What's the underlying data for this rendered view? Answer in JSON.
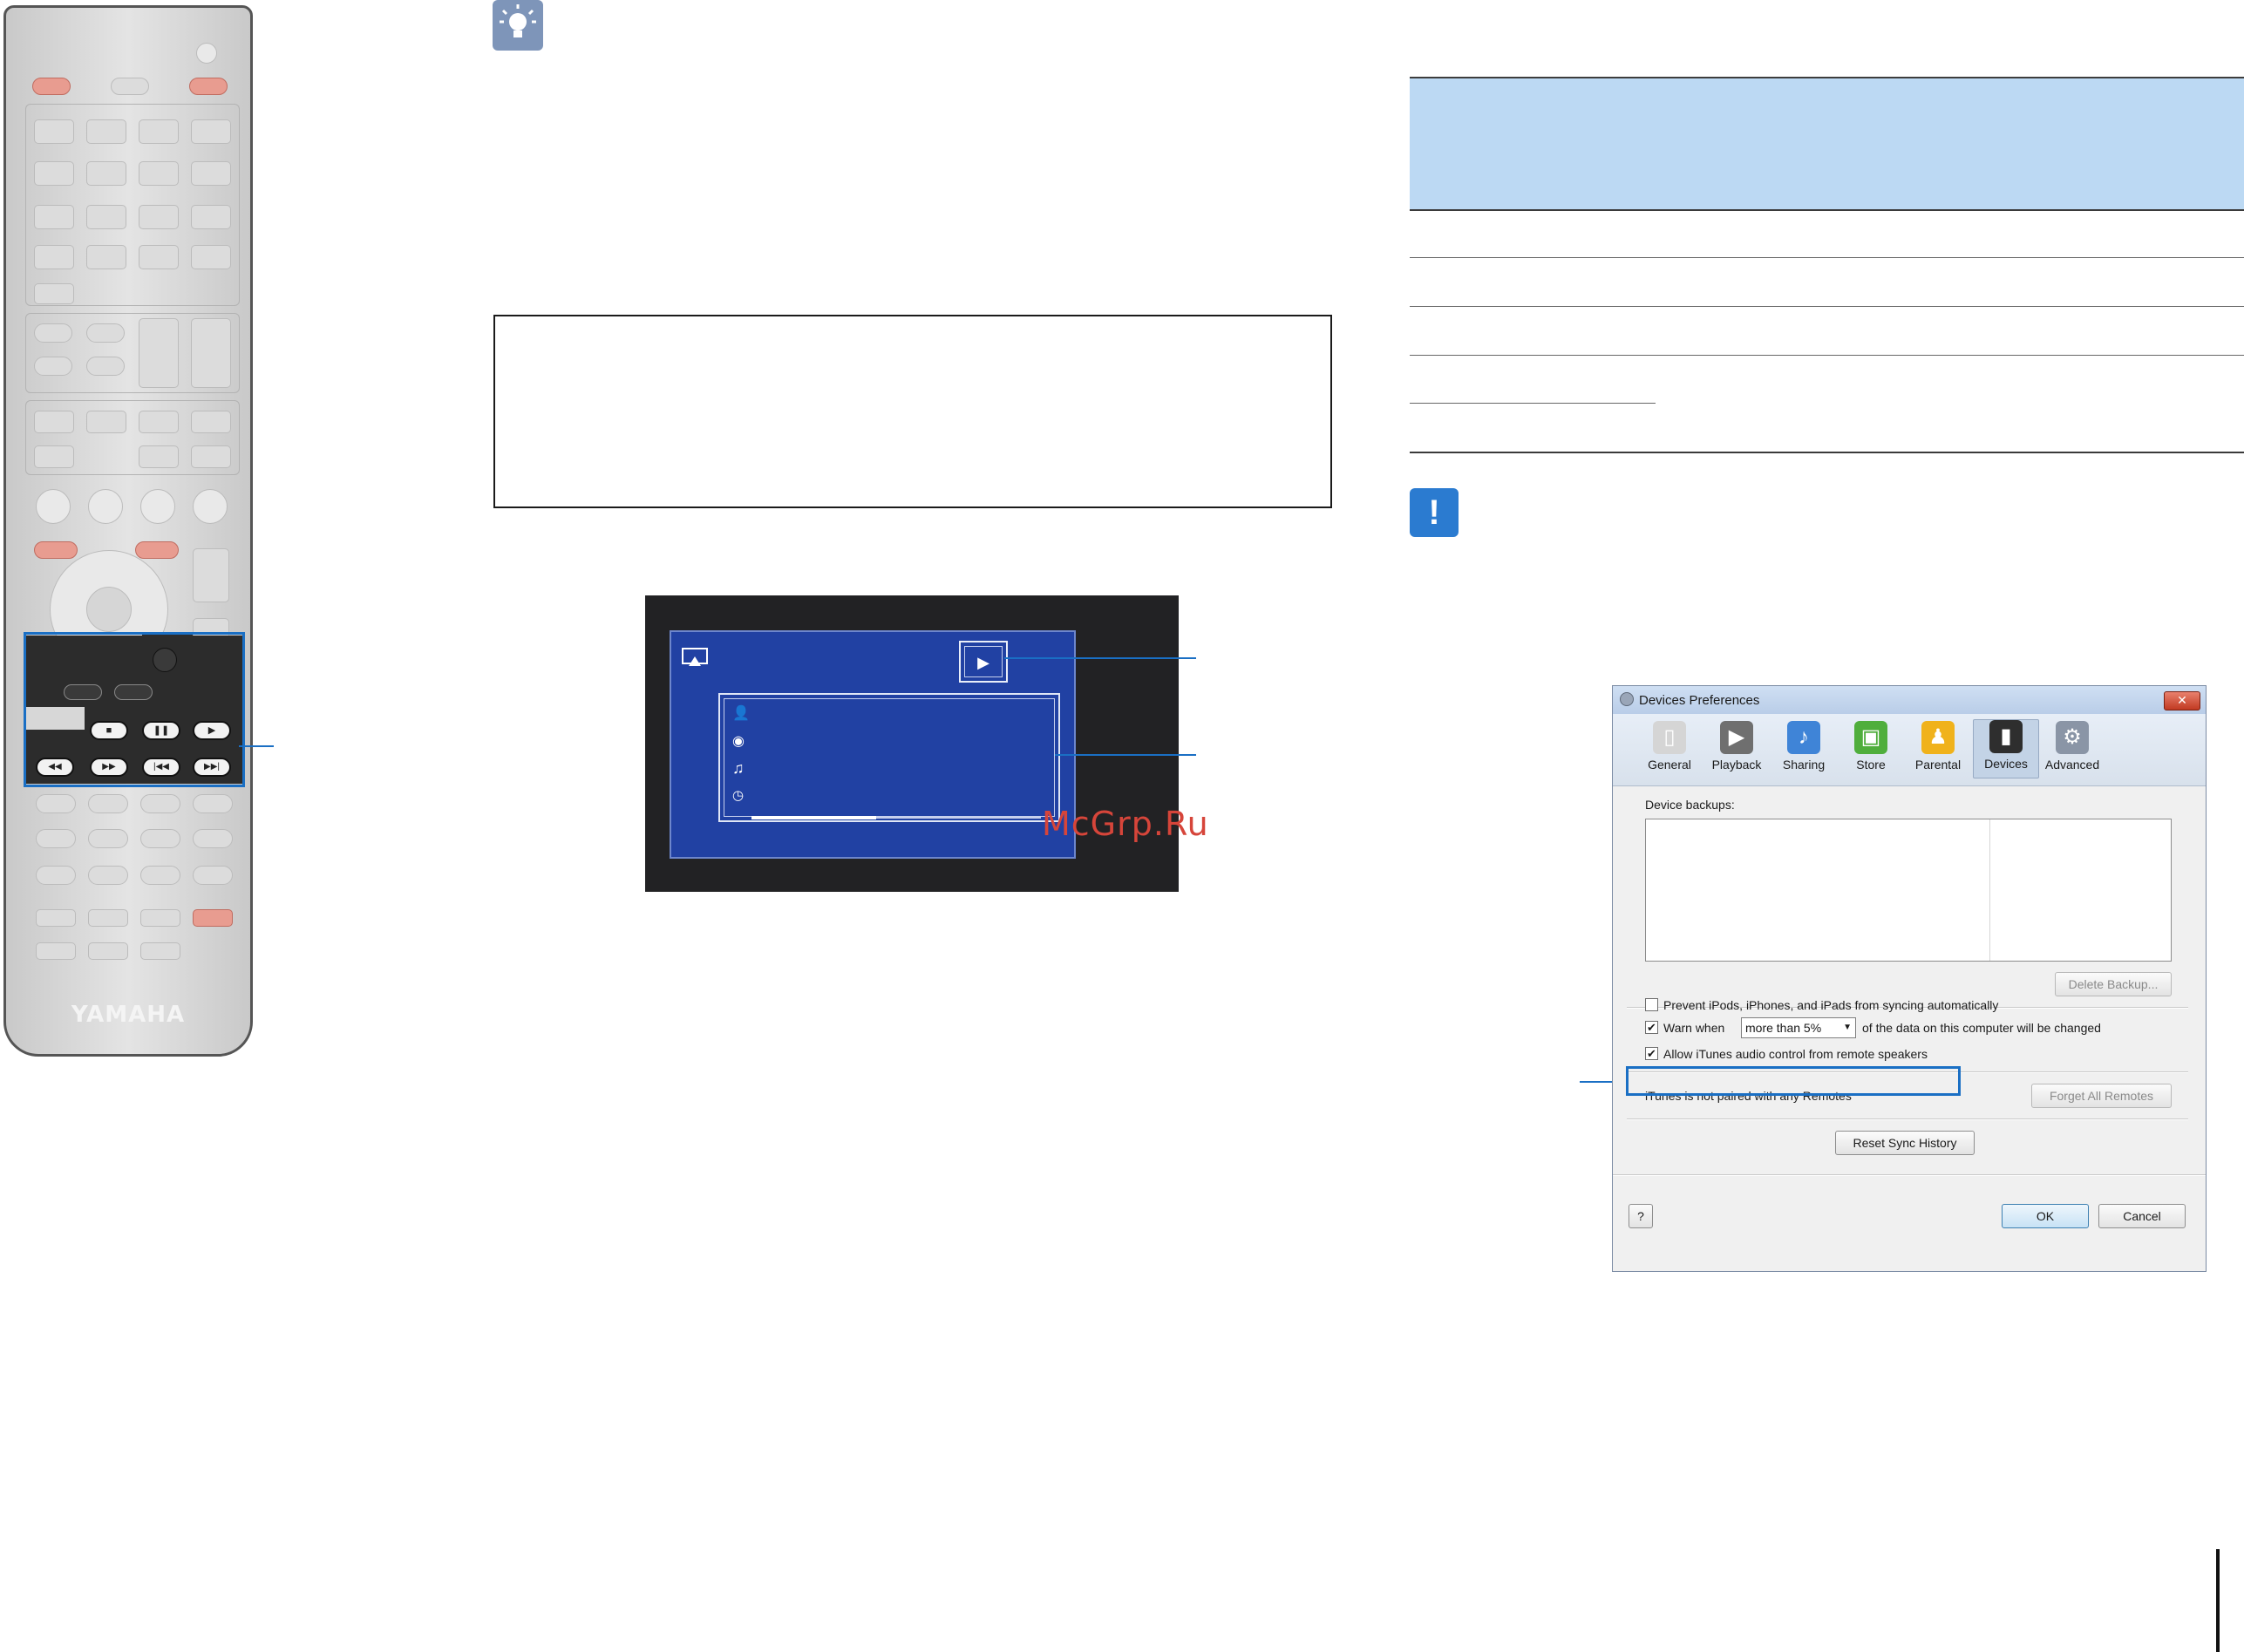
{
  "remote": {
    "brand": "YAMAHA"
  },
  "tv_screen": {
    "progress_fraction": 0.43
  },
  "watermark": "McGrp.Ru",
  "itunes_dialog": {
    "title": "Devices Preferences",
    "close_label": "✕",
    "toolbar": [
      {
        "label": "General",
        "icon": "general-switch-icon",
        "color": "#d5d5d5",
        "glyph": "▯"
      },
      {
        "label": "Playback",
        "icon": "playback-icon",
        "color": "#6f6f6f",
        "glyph": "▶"
      },
      {
        "label": "Sharing",
        "icon": "sharing-icon",
        "color": "#3f84d7",
        "glyph": "♪"
      },
      {
        "label": "Store",
        "icon": "store-bag-icon",
        "color": "#4fae3c",
        "glyph": "▣"
      },
      {
        "label": "Parental",
        "icon": "parental-icon",
        "color": "#f0b21b",
        "glyph": "♟"
      },
      {
        "label": "Devices",
        "icon": "devices-iphone-icon",
        "color": "#2e2e2e",
        "glyph": "▮"
      },
      {
        "label": "Advanced",
        "icon": "advanced-gear-icon",
        "color": "#8a95a6",
        "glyph": "⚙"
      }
    ],
    "device_backups_label": "Device backups:",
    "delete_backup_label": "Delete Backup...",
    "prevent_sync_label": "Prevent iPods, iPhones, and iPads from syncing automatically",
    "prevent_sync_checked": false,
    "warn_when_label": "Warn when",
    "warn_when_checked": true,
    "warn_threshold_value": "more than 5%",
    "warn_suffix_label": "of the data on this computer will be changed",
    "allow_remote_label": "Allow iTunes audio control from remote speakers",
    "allow_remote_checked": true,
    "remotes_status": "iTunes is not paired with any Remotes",
    "forget_remotes_label": "Forget All Remotes",
    "reset_sync_label": "Reset Sync History",
    "help_label": "?",
    "ok_label": "OK",
    "cancel_label": "Cancel"
  },
  "colors": {
    "callout_blue": "#1a6fc4",
    "table_header_bg": "#bcd9f3",
    "tv_screen_blue": "#2141a3",
    "tip_icon": "#7e95b9",
    "caution_icon": "#2b7bd0"
  }
}
